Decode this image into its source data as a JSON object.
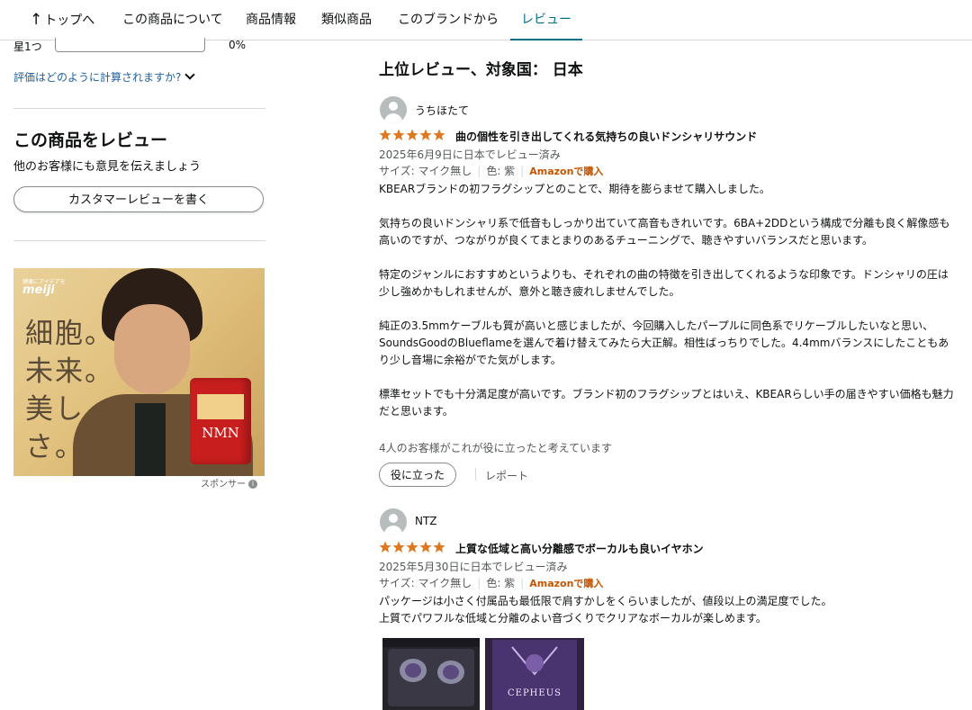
{
  "nav": {
    "back_arrow": "↑",
    "back_label": "トップへ",
    "items": [
      {
        "label": "この商品について"
      },
      {
        "label": "商品情報"
      },
      {
        "label": "類似商品"
      },
      {
        "label": "このブランドから"
      },
      {
        "label": "レビュー",
        "active": true
      }
    ]
  },
  "sidebar": {
    "star1_label": "星1つ",
    "star1_percent_value": 0,
    "star1_percent": "0%",
    "calc_link": "評価はどのように計算されますか?",
    "review_title": "この商品をレビュー",
    "review_sub": "他のお客様にも意見を伝えましょう",
    "write_button": "カスタマーレビューを書く",
    "ad": {
      "brand_small": "健康にアイデアを",
      "brand": "meiji",
      "copy_lines": [
        "細胞。",
        "未来。",
        "美しさ。"
      ],
      "product_text": "NMN"
    },
    "sponsor_label": "スポンサー",
    "info_icon": "i"
  },
  "main": {
    "heading": "上位レビュー、対象国： 日本",
    "reviews": [
      {
        "name": "うちほたて",
        "rating": 5,
        "title": "曲の個性を引き出してくれる気持ちの良いドンシャリサウンド",
        "date": "2025年6月9日に日本でレビュー済み",
        "size": "サイズ: マイク無し",
        "color": "色: 紫",
        "verified": "Amazonで購入",
        "paragraphs": [
          "KBEARブランドの初フラグシップとのことで、期待を膨らませて購入しました。",
          "気持ちの良いドンシャリ系で低音もしっかり出ていて高音もきれいです。6BA+2DDという構成で分離も良く解像感も高いのですが、つながりが良くてまとまりのあるチューニングで、聴きやすいバランスだと思います。",
          "特定のジャンルにおすすめというよりも、それぞれの曲の特徴を引き出してくれるような印象です。ドンシャリの圧は少し強めかもしれませんが、意外と聴き疲れしませんでした。",
          "純正の3.5mmケーブルも質が高いと感じましたが、今回購入したパープルに同色系でリケーブルしたいなと思い、SoundsGoodのBlueflameを選んで着け替えてみたら大正解。相性ばっちりでした。4.4mmバランスにしたこともあり少し音場に余裕がでた気がします。",
          "標準セットでも十分満足度が高いです。ブランド初のフラグシップとはいえ、KBEARらしい手の届きやすい価格も魅力だと思います。"
        ],
        "helpful_text": "4人のお客様がこれが役に立ったと考えています",
        "helpful_button": "役に立った",
        "report": "レポート"
      },
      {
        "name": "NTZ",
        "rating": 5,
        "title": "上質な低域と高い分離感でボーカルも良いイヤホン",
        "date": "2025年5月30日に日本でレビュー済み",
        "size": "サイズ: マイク無し",
        "color": "色: 紫",
        "verified": "Amazonで購入",
        "paragraphs": [
          "パッケージは小さく付属品も最低限で肩すかしをくらいましたが、値段以上の満足度でした。",
          "上質でパワフルな低域と分離のよい音づくりでクリアなボーカルが楽しめます。"
        ],
        "images": [
          {
            "text": ""
          },
          {
            "text": "CEPHEUS"
          }
        ]
      }
    ]
  },
  "colors": {
    "link": "#2162a1",
    "accent": "#007185",
    "star": "#de7921",
    "verified": "#c45500",
    "muted": "#565959"
  }
}
